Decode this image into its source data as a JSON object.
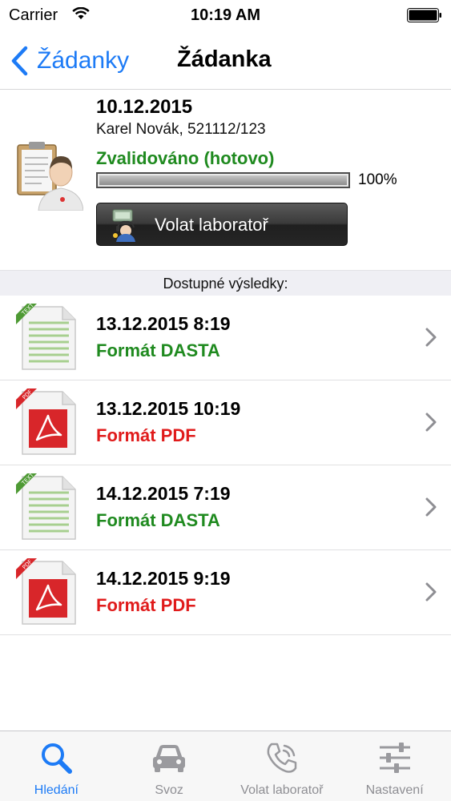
{
  "status_bar": {
    "carrier": "Carrier",
    "time": "10:19 AM"
  },
  "nav": {
    "back_label": "Žádanky",
    "title": "Žádanka"
  },
  "header": {
    "date": "10.12.2015",
    "patient": "Karel Novák, 521112/123",
    "status": "Zvalidováno (hotovo)",
    "progress_value": 100,
    "progress_text": "100%",
    "call_button_label": "Volat laboratoř"
  },
  "section_title": "Dostupné výsledky:",
  "results": [
    {
      "date": "13.12.2015 8:19",
      "format": "Formát DASTA",
      "kind": "text",
      "icon_tag": "TEXT"
    },
    {
      "date": "13.12.2015 10:19",
      "format": "Formát PDF",
      "kind": "pdf",
      "icon_tag": "PDF"
    },
    {
      "date": "14.12.2015 7:19",
      "format": "Formát DASTA",
      "kind": "text",
      "icon_tag": "TEXT"
    },
    {
      "date": "14.12.2015 9:19",
      "format": "Formát PDF",
      "kind": "pdf",
      "icon_tag": "PDF"
    }
  ],
  "tabs": [
    {
      "label": "Hledání",
      "icon": "search-icon",
      "active": true
    },
    {
      "label": "Svoz",
      "icon": "car-icon",
      "active": false
    },
    {
      "label": "Volat laboratoř",
      "icon": "phone-icon",
      "active": false
    },
    {
      "label": "Nastavení",
      "icon": "sliders-icon",
      "active": false
    }
  ],
  "colors": {
    "accent": "#1d7bf6",
    "green": "#1f8a1f",
    "red": "#e01b1b",
    "section_bg": "#efeff4"
  }
}
